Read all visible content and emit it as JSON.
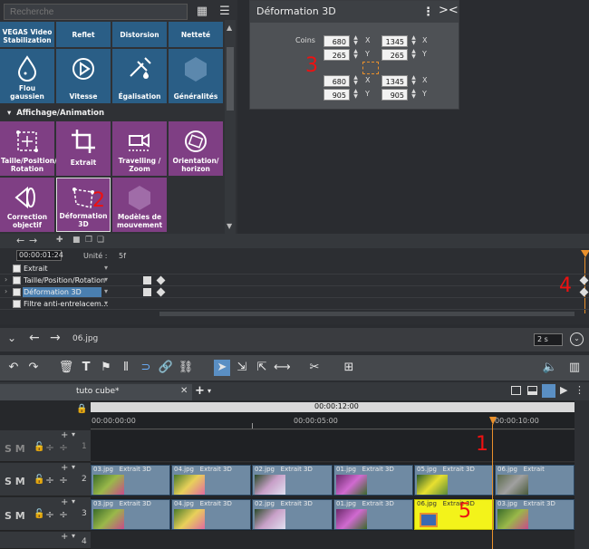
{
  "search": {
    "placeholder": "Recherche"
  },
  "effects": {
    "row1": [
      {
        "label": "VEGAS Video Stabilization"
      },
      {
        "label": "Reflet"
      },
      {
        "label": "Distorsion"
      },
      {
        "label": "Netteté"
      }
    ],
    "row2": [
      {
        "label": "Flou gaussien",
        "icon": "drop-icon"
      },
      {
        "label": "Vitesse",
        "icon": "speed-icon"
      },
      {
        "label": "Égalisation",
        "icon": "equalize-icon"
      },
      {
        "label": "Généralités",
        "icon": "hexagon-icon"
      }
    ],
    "section_title": "Affichage/Animation",
    "row3": [
      {
        "label": "Taille/Position/ Rotation",
        "icon": "transform-icon"
      },
      {
        "label": "Extrait",
        "icon": "crop-icon"
      },
      {
        "label": "Travelling / Zoom",
        "icon": "camera-icon"
      },
      {
        "label": "Orientation/ horizon",
        "icon": "rotate-icon"
      }
    ],
    "row4": [
      {
        "label": "Correction objectif",
        "icon": "lens-icon"
      },
      {
        "label": "Déformation 3D",
        "icon": "deform-icon"
      },
      {
        "label": "Modèles de mouvement",
        "icon": "hexagon-icon"
      }
    ]
  },
  "dialog": {
    "title": "Déformation 3D",
    "corners_label": "Coins",
    "fields": {
      "tl_x": "680",
      "tr_x": "1345",
      "tl_y": "265",
      "tr_y": "265",
      "bl_x": "680",
      "br_x": "1345",
      "bl_y": "905",
      "br_y": "905"
    },
    "x_label": "X",
    "y_label": "Y"
  },
  "keyframes": {
    "timecode": "00:00:01:24",
    "unit_label": "Unité :",
    "unit_value": "5f",
    "rows": [
      "Extrait",
      "Taille/Position/Rotation",
      "Déformation 3D",
      "Filtre anti-entrelacem..."
    ]
  },
  "navbar": {
    "filename": "06.jpg",
    "zoom": "2 s"
  },
  "tabs": {
    "project": "tuto cube*"
  },
  "timeline": {
    "ruler_center": "00:00:12:00",
    "ruler_ticks": [
      "00:00:00:00",
      "00:00:05:00",
      "00:00:10:00"
    ],
    "track_letters": "S M",
    "tracks": [
      "1",
      "2",
      "3",
      "4"
    ],
    "clip_labels": {
      "c1": "03.jpg",
      "c2": "Extrait 3D",
      "c3": "04.jpg",
      "c4": "Extrait 3D",
      "c5": "02.jpg",
      "c6": "Extrait 3D",
      "c7": "01.jpg",
      "c8": "Extrait 3D",
      "c9": "05.jpg",
      "c10": "Extrait 3D",
      "c11": "06.jpg",
      "c12": "Extrait"
    }
  },
  "annotations": [
    "1",
    "2",
    "3",
    "4",
    "5"
  ],
  "colors": {
    "tile_blue": "#2a5e86",
    "tile_purple": "#7f3f84",
    "clip_blue": "#6f8aa3",
    "clip_selected": "#f3f31a",
    "playhead": "#e9902c",
    "annotation_red": "#e11111"
  }
}
